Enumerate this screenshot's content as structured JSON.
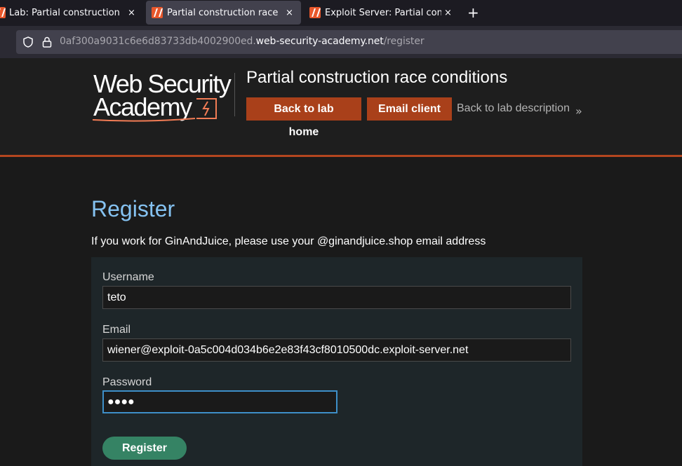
{
  "browser": {
    "tabs": [
      {
        "label": "Lab: Partial construction race conditions"
      },
      {
        "label": "Partial construction race conditions"
      },
      {
        "label": "Exploit Server: Partial construction race conditions"
      }
    ],
    "new_tab_symbol": "+",
    "close_symbol": "×",
    "url": {
      "prefix": "0af300a9031c6e6d83733db4002900ed.",
      "domain": "web-security-academy.net",
      "path": "/register"
    }
  },
  "header": {
    "logo_line1": "Web Security",
    "logo_line2": "Academy",
    "lab_title": "Partial construction race conditions",
    "buttons": {
      "back_to_lab_home": "Back to lab home",
      "email_client": "Email client"
    },
    "back_to_description": "Back to lab description",
    "back_chevron": "»"
  },
  "register": {
    "title": "Register",
    "note": "If you work for GinAndJuice, please use your @ginandjuice.shop email address",
    "fields": {
      "username_label": "Username",
      "username_value": "teto",
      "email_label": "Email",
      "email_value": "wiener@exploit-0a5c004d034b6e2e83f43cf8010500dc.exploit-server.net",
      "password_label": "Password",
      "password_value": "●●●●"
    },
    "submit_label": "Register"
  },
  "colors": {
    "accent_orange": "#a9401a",
    "link_blue": "#85c2f1",
    "register_green": "#358364",
    "focus_blue": "#3e8fc8"
  }
}
